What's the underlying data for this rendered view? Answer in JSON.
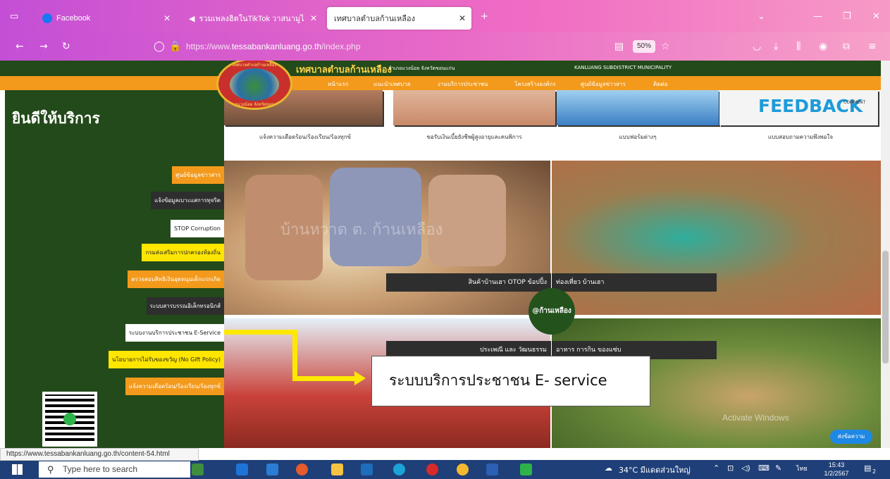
{
  "browser": {
    "tabs": [
      {
        "label": "Facebook",
        "active": false
      },
      {
        "label": "รวมเพลงฮิตในTikTok วาสนามูไต",
        "active": false
      },
      {
        "label": "เทศบาลตำบลก้านเหลือง",
        "active": true
      }
    ],
    "url": {
      "scheme": "https://www.",
      "domain": "tessabankanluang.go.th",
      "path": "/index.php"
    },
    "zoom": "50%"
  },
  "site": {
    "title": "เทศบาลตำบลก้านเหลือง",
    "location": "อำเภอแวงน้อย จังหวัดขอนแก่น",
    "english": "KANLUANG SUBDISTRICT MUNICIPALITY",
    "menu": [
      "หน้าแรก",
      "แนะนำเทศบาล",
      "งานบริการประชาชน",
      "โครงสร้างองค์กร",
      "ศูนย์ข้อมูลข่าวสาร",
      "ติดต่อ"
    ],
    "logo_text_top": "เทศบาลตำบลก้านเหลือง",
    "logo_text_bottom": "อำเภอแวงน้อย จังหวัดขอนแก่น"
  },
  "sidebar": {
    "welcome": "ยินดีให้บริการ",
    "buttons": [
      {
        "label": "ศูนย์ข้อมูลข่าวสาร",
        "style": "orange"
      },
      {
        "label": "แจ้งข้อมูลเบาะแสการทุจริต",
        "style": "dark"
      },
      {
        "label": "STOP Corruption",
        "style": "white"
      },
      {
        "label": "กรมส่งเสริมการปกครองท้องถิ่น",
        "style": "yellow"
      },
      {
        "label": "ตรวจสอบสิทธิเงินอุดหนุนเด็กแรกเกิด",
        "style": "orange"
      },
      {
        "label": "ระบบสารบรรณอิเล็กทรอนิกส์",
        "style": "dark"
      },
      {
        "label": "ระบบงานบริการประชาชน E-Service",
        "style": "white"
      },
      {
        "label": "นโยบายการไม่รับของขวัญ (No Gift Policy)",
        "style": "yellow"
      },
      {
        "label": "แจ้งความเดือดร้อน/ร้องเรียน/ร้องทุกข์",
        "style": "orange"
      }
    ]
  },
  "top_cards": [
    {
      "caption": "แจ้งความเดือดร้อน/ร้องเรียน/ร้องทุกข์"
    },
    {
      "caption": "ขอรับเงินเบี้ยยังชีพผู้สูงอายุและคนพิการ"
    },
    {
      "caption": "แบบฟอร์มต่างๆ"
    },
    {
      "caption": "แบบสอบถามความพึงพอใจ"
    }
  ],
  "feedback_text": "FEEDBACK",
  "feedback_small": "COMMENT",
  "photo_captions": {
    "otop": "สินค้าบ้านเฮา OTOP ข้อปปิ้ง",
    "travel": "ท่องเที่ยว บ้านเฮา",
    "culture": "ประเพณี และ วัฒนธรรม",
    "food": "อาหาร การกิน ของแซ่บ"
  },
  "photo_watermark": "บ้านหวาด ต. ก้านเหลือง",
  "badge": "@ก้านเหลือง",
  "callout": "ระบบบริการประชาชน E- service",
  "chat_button": "ส่งข้อความ",
  "activate_watermark": "Activate Windows",
  "status_bar_url": "https://www.tessabankanluang.go.th/content-54.html",
  "taskbar": {
    "search_placeholder": "Type here to search",
    "weather": "34°C มีแดดส่วนใหญ่",
    "lang": "ไทย",
    "time": "15:43",
    "date": "1/2/2567",
    "notif_count": "2"
  },
  "colors": {
    "site_green": "#234a1a",
    "site_orange": "#f39a1c",
    "callout_arrow": "#ffe800",
    "browser_gradient_start": "#c44fd6"
  }
}
